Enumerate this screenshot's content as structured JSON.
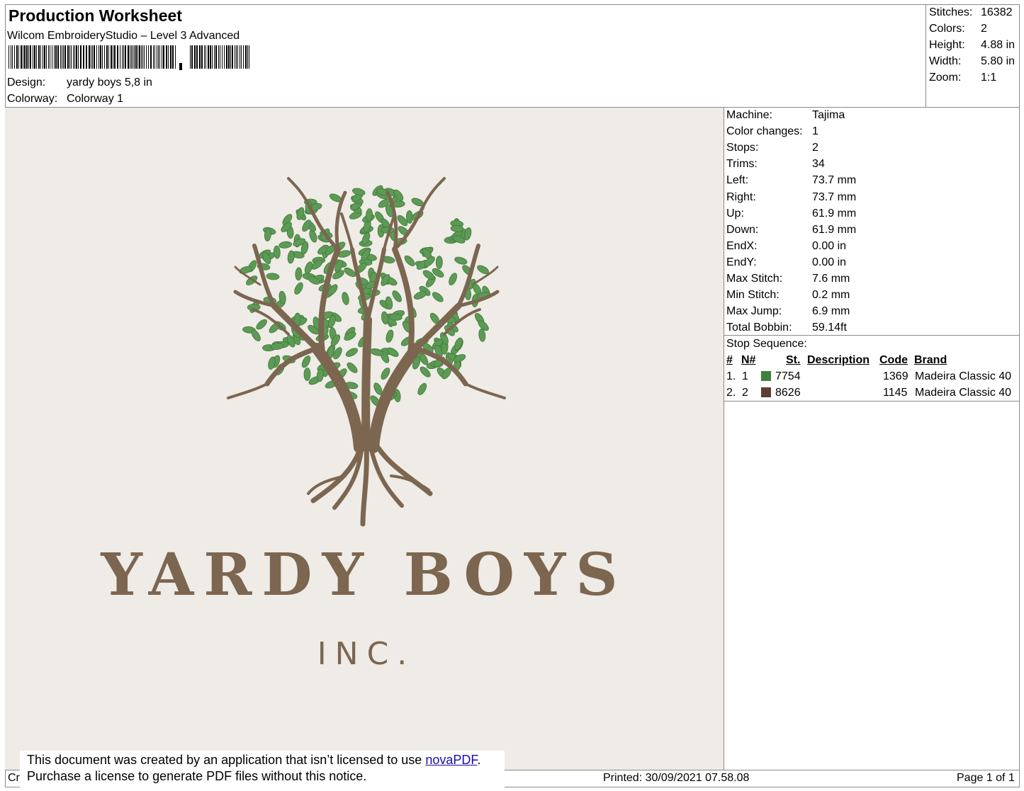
{
  "header": {
    "title": "Production Worksheet",
    "subtitle": "Wilcom EmbroideryStudio – Level 3 Advanced",
    "design_label": "Design:",
    "design_value": "yardy boys 5,8 in",
    "colorway_label": "Colorway:",
    "colorway_value": "Colorway 1"
  },
  "stats": [
    {
      "label": "Stitches:",
      "value": "16382"
    },
    {
      "label": "Colors:",
      "value": "2"
    },
    {
      "label": "Height:",
      "value": "4.88 in"
    },
    {
      "label": "Width:",
      "value": "5.80 in"
    },
    {
      "label": "Zoom:",
      "value": "1:1"
    }
  ],
  "machine": [
    {
      "label": "Machine:",
      "value": "Tajima"
    },
    {
      "label": "Color changes:",
      "value": "1"
    },
    {
      "label": "Stops:",
      "value": "2"
    },
    {
      "label": "Trims:",
      "value": "34"
    },
    {
      "label": "Left:",
      "value": "73.7 mm"
    },
    {
      "label": "Right:",
      "value": "73.7 mm"
    },
    {
      "label": "Up:",
      "value": "61.9 mm"
    },
    {
      "label": "Down:",
      "value": "61.9 mm"
    },
    {
      "label": "EndX:",
      "value": "0.00 in"
    },
    {
      "label": "EndY:",
      "value": "0.00 in"
    },
    {
      "label": "Max Stitch:",
      "value": "7.6 mm"
    },
    {
      "label": "Min Stitch:",
      "value": "0.2 mm"
    },
    {
      "label": "Max Jump:",
      "value": "6.9 mm"
    },
    {
      "label": "Total Bobbin:",
      "value": "59.14ft"
    }
  ],
  "stop_sequence": {
    "title": "Stop Sequence:",
    "columns": {
      "num": "#",
      "n": "N#",
      "st": "St.",
      "description": "Description",
      "code": "Code",
      "brand": "Brand"
    },
    "rows": [
      {
        "num": "1.",
        "n": "1",
        "color": "#3f7f3f",
        "st": "7754",
        "description": "",
        "code": "1369",
        "brand": "Madeira Classic 40"
      },
      {
        "num": "2.",
        "n": "2",
        "color": "#5b3f35",
        "st": "8626",
        "description": "",
        "code": "1145",
        "brand": "Madeira Classic 40"
      }
    ]
  },
  "design": {
    "logo_line1": "YARDY BOYS",
    "logo_line2": "INC.",
    "thread_green": "#5d9a55",
    "thread_brown": "#7c6650",
    "background": "#efebe6"
  },
  "footer": {
    "left_fragment": "Cr",
    "printed": "Printed: 30/09/2021 07.58.08",
    "page": "Page 1 of 1"
  },
  "notice": {
    "line1_prefix": "This document was created by an application that isn’t licensed to use ",
    "link_text": "novaPDF",
    "line1_suffix": ".",
    "line2": "Purchase a license to generate PDF files without this notice."
  }
}
